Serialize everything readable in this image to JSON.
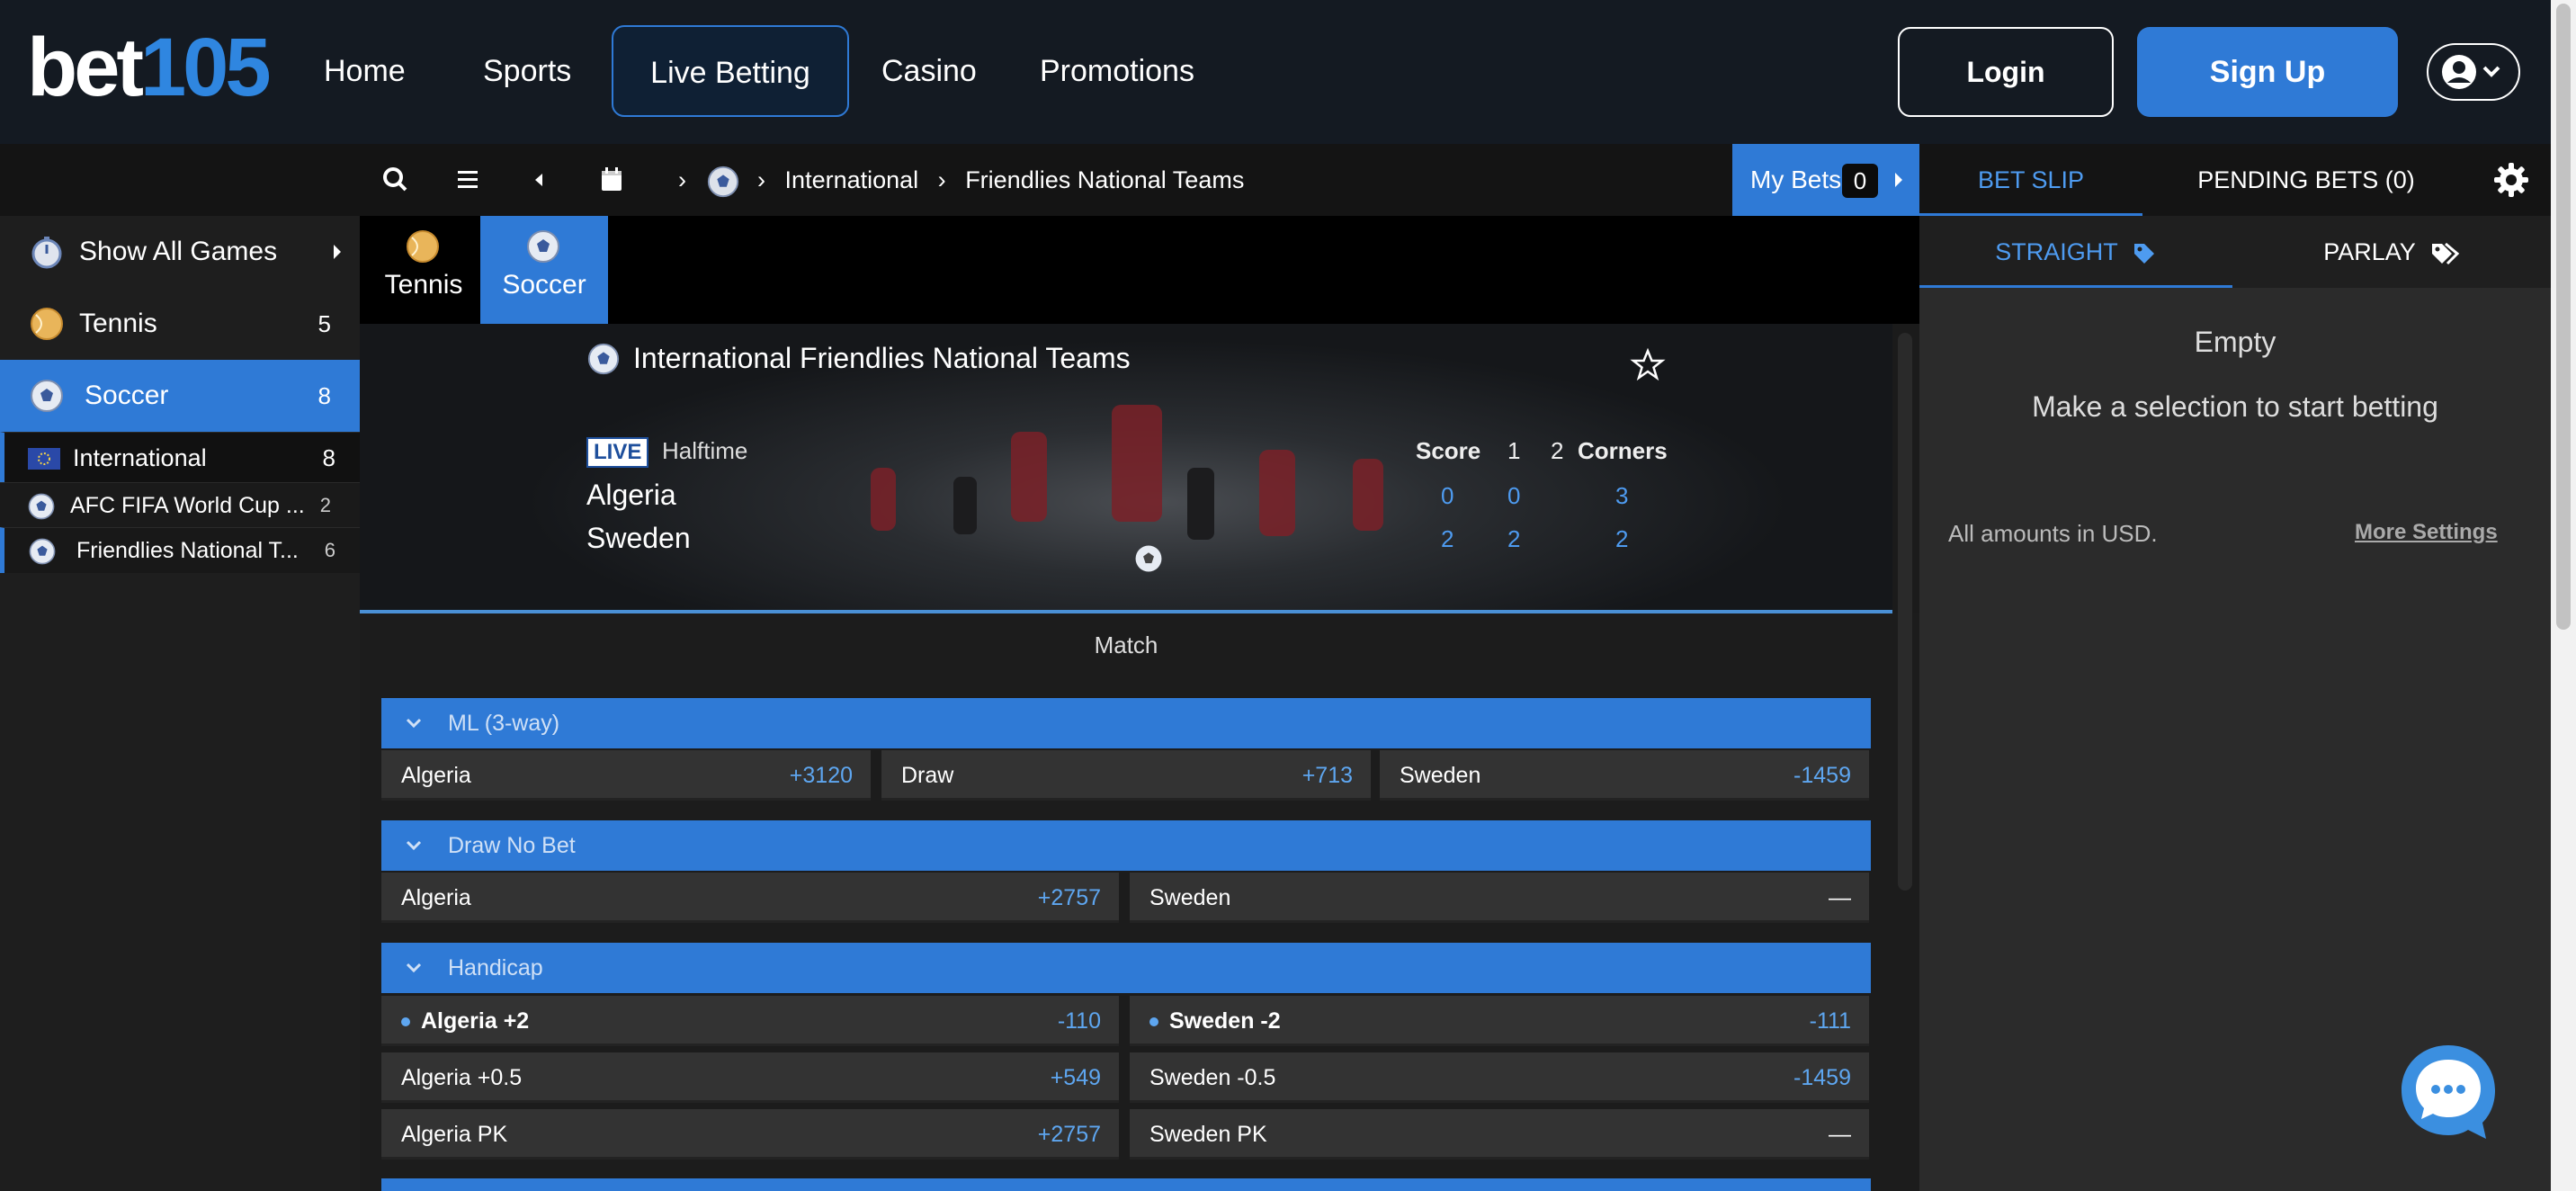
{
  "brand": {
    "logo_word": "bet",
    "logo_num": "105"
  },
  "nav": {
    "items": [
      "Home",
      "Sports",
      "Live Betting",
      "Casino",
      "Promotions"
    ],
    "active": "Live Betting",
    "login": "Login",
    "signup": "Sign Up"
  },
  "toolbar": {
    "icons": [
      "search-icon",
      "menu-icon",
      "back-icon",
      "calendar-icon"
    ],
    "breadcrumb": [
      "International",
      "Friendlies National Teams"
    ],
    "my_bets_label": "My Bets",
    "my_bets_count": "0"
  },
  "sidebar": {
    "items": [
      {
        "label": "Show All Games",
        "count": ""
      },
      {
        "label": "Tennis",
        "count": "5"
      },
      {
        "label": "Soccer",
        "count": "8"
      }
    ],
    "sub": [
      {
        "label": "International",
        "count": "8"
      },
      {
        "label": "AFC FIFA World Cup ...",
        "count": "2"
      },
      {
        "label": "Friendlies National T...",
        "count": "6"
      }
    ]
  },
  "sport_tabs": [
    "Tennis",
    "Soccer"
  ],
  "event": {
    "title": "International Friendlies National Teams",
    "live_badge": "LIVE",
    "status": "Halftime",
    "score_headers": [
      "Score",
      "1",
      "2",
      "Corners"
    ],
    "teams": [
      {
        "name": "Algeria",
        "score": "0",
        "h1": "0",
        "corners": "3"
      },
      {
        "name": "Sweden",
        "score": "2",
        "h1": "2",
        "corners": "2"
      }
    ]
  },
  "match_label": "Match",
  "markets": {
    "ml": {
      "title": "ML (3-way)",
      "odds": [
        {
          "name": "Algeria",
          "price": "+3120"
        },
        {
          "name": "Draw",
          "price": "+713"
        },
        {
          "name": "Sweden",
          "price": "-1459"
        }
      ]
    },
    "dnb": {
      "title": "Draw No Bet",
      "odds": [
        {
          "name": "Algeria",
          "price": "+2757"
        },
        {
          "name": "Sweden",
          "price": "—"
        }
      ]
    },
    "handicap": {
      "title": "Handicap",
      "rows": [
        [
          {
            "name": "Algeria +2",
            "price": "-110"
          },
          {
            "name": "Sweden -2",
            "price": "-111"
          }
        ],
        [
          {
            "name": "Algeria +0.5",
            "price": "+549"
          },
          {
            "name": "Sweden -0.5",
            "price": "-1459"
          }
        ],
        [
          {
            "name": "Algeria PK",
            "price": "+2757"
          },
          {
            "name": "Sweden PK",
            "price": "—"
          }
        ]
      ]
    }
  },
  "betslip": {
    "tabs": [
      "BET SLIP",
      "PENDING BETS (0)"
    ],
    "subtabs": [
      "STRAIGHT",
      "PARLAY"
    ],
    "empty_title": "Empty",
    "empty_msg": "Make a selection to start betting",
    "currency_note": "All amounts in USD.",
    "more_settings": "More Settings"
  },
  "colors": {
    "accent": "#2f7ad6",
    "odds": "#5ea6f0",
    "bg": "#1b1b1b",
    "nav_bg": "#141a22"
  }
}
